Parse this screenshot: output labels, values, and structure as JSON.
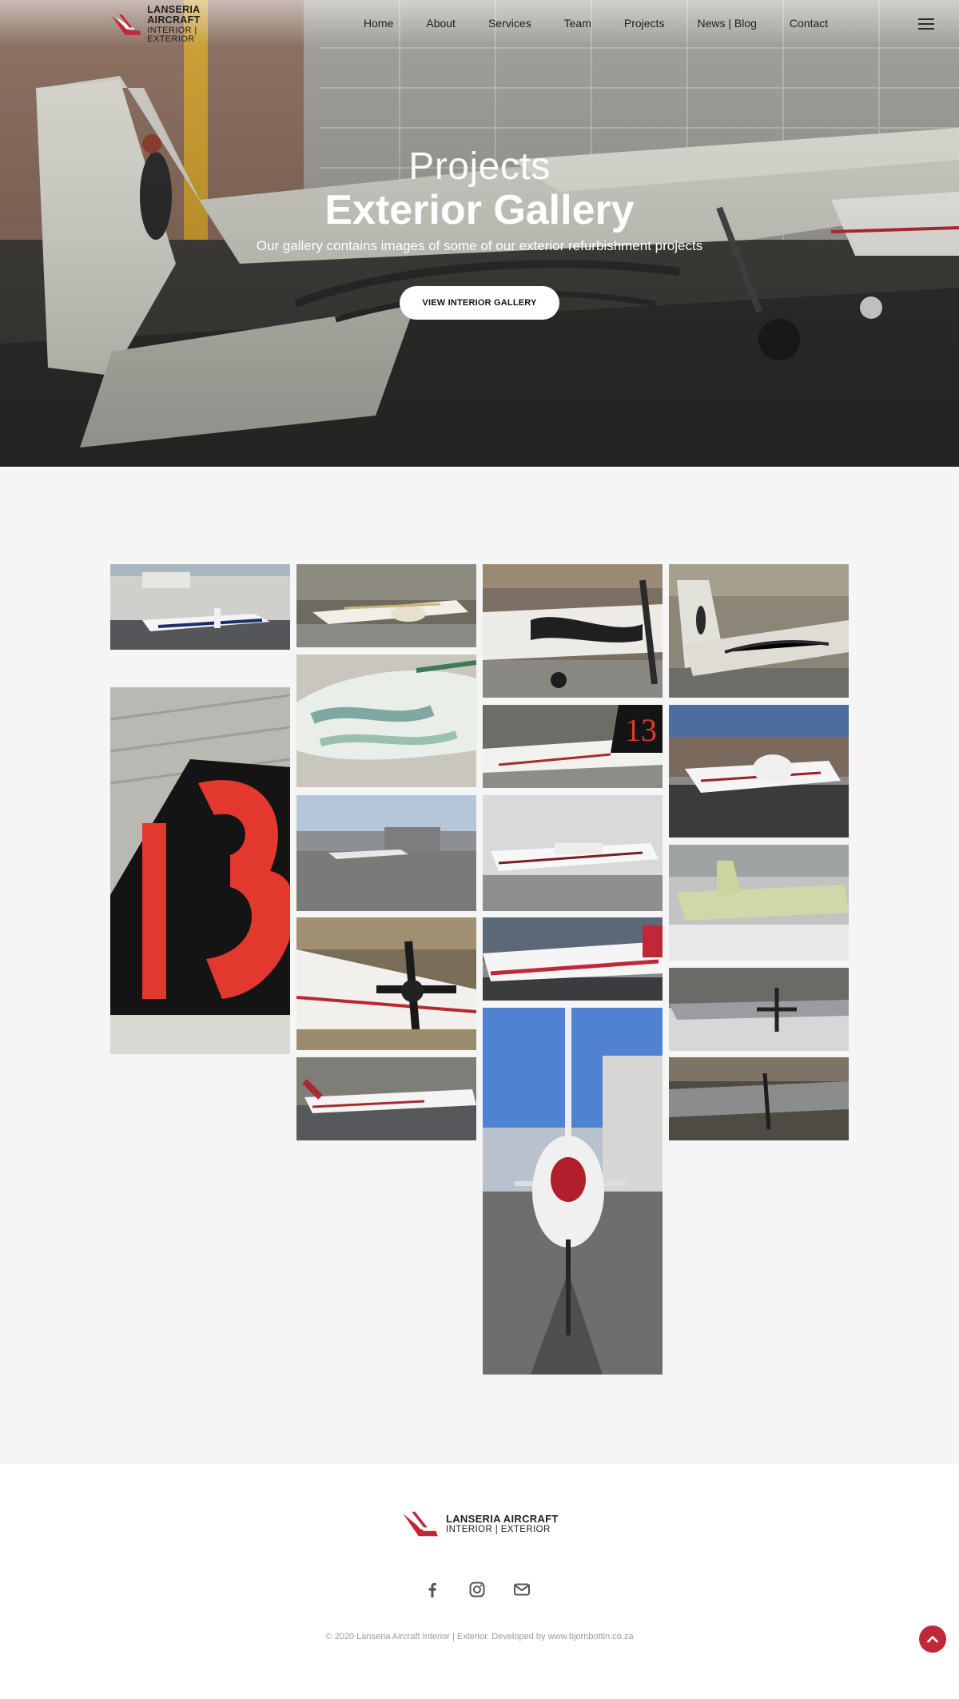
{
  "brand": {
    "name_line1": "LANSERIA AIRCRAFT",
    "name_line2": "INTERIOR | EXTERIOR",
    "accent": "#c0283a"
  },
  "nav": {
    "items": [
      {
        "label": "Home"
      },
      {
        "label": "About"
      },
      {
        "label": "Services"
      },
      {
        "label": "Team"
      },
      {
        "label": "Projects"
      },
      {
        "label": "News | Blog"
      },
      {
        "label": "Contact"
      }
    ],
    "menu_icon": "hamburger-icon"
  },
  "hero": {
    "kicker": "Projects",
    "title": "Exterior Gallery",
    "subtitle": "Our gallery contains images of some of our exterior refurbishment projects",
    "button_label": "VIEW INTERIOR GALLERY"
  },
  "gallery": {
    "images": [
      {
        "subject": "white-blue-cessna-outside-hangar"
      },
      {
        "subject": "tail-number-13"
      },
      {
        "subject": "twin-engine-in-hangar"
      },
      {
        "subject": "fuselage-in-paint-prep"
      },
      {
        "subject": "twin-engine-apron"
      },
      {
        "subject": "turboprop-propeller-closeup"
      },
      {
        "subject": "jets-on-apron"
      },
      {
        "subject": "flame-livery-cessna"
      },
      {
        "subject": "zs-jej-tail-13"
      },
      {
        "subject": "cessna-twin-cloudy-sky"
      },
      {
        "subject": "red-stripe-turboprop"
      },
      {
        "subject": "pc12-nose-on"
      },
      {
        "subject": "zs-fnf-cessna-hangar"
      },
      {
        "subject": "twin-engine-at-dusk"
      },
      {
        "subject": "primer-green-airframe"
      },
      {
        "subject": "grey-turboprop-hangar"
      },
      {
        "subject": "bare-metal-turboprop"
      }
    ]
  },
  "footer": {
    "brand_line1": "LANSERIA AIRCRAFT",
    "brand_line2": "INTERIOR | EXTERIOR",
    "socials": [
      "facebook-icon",
      "instagram-icon",
      "envelope-icon"
    ],
    "copyright": "© 2020 Lanseria Aircraft Interior | Exterior. Developed by www.bjornbottin.co.za"
  },
  "back_to_top_icon": "chevron-up-icon"
}
